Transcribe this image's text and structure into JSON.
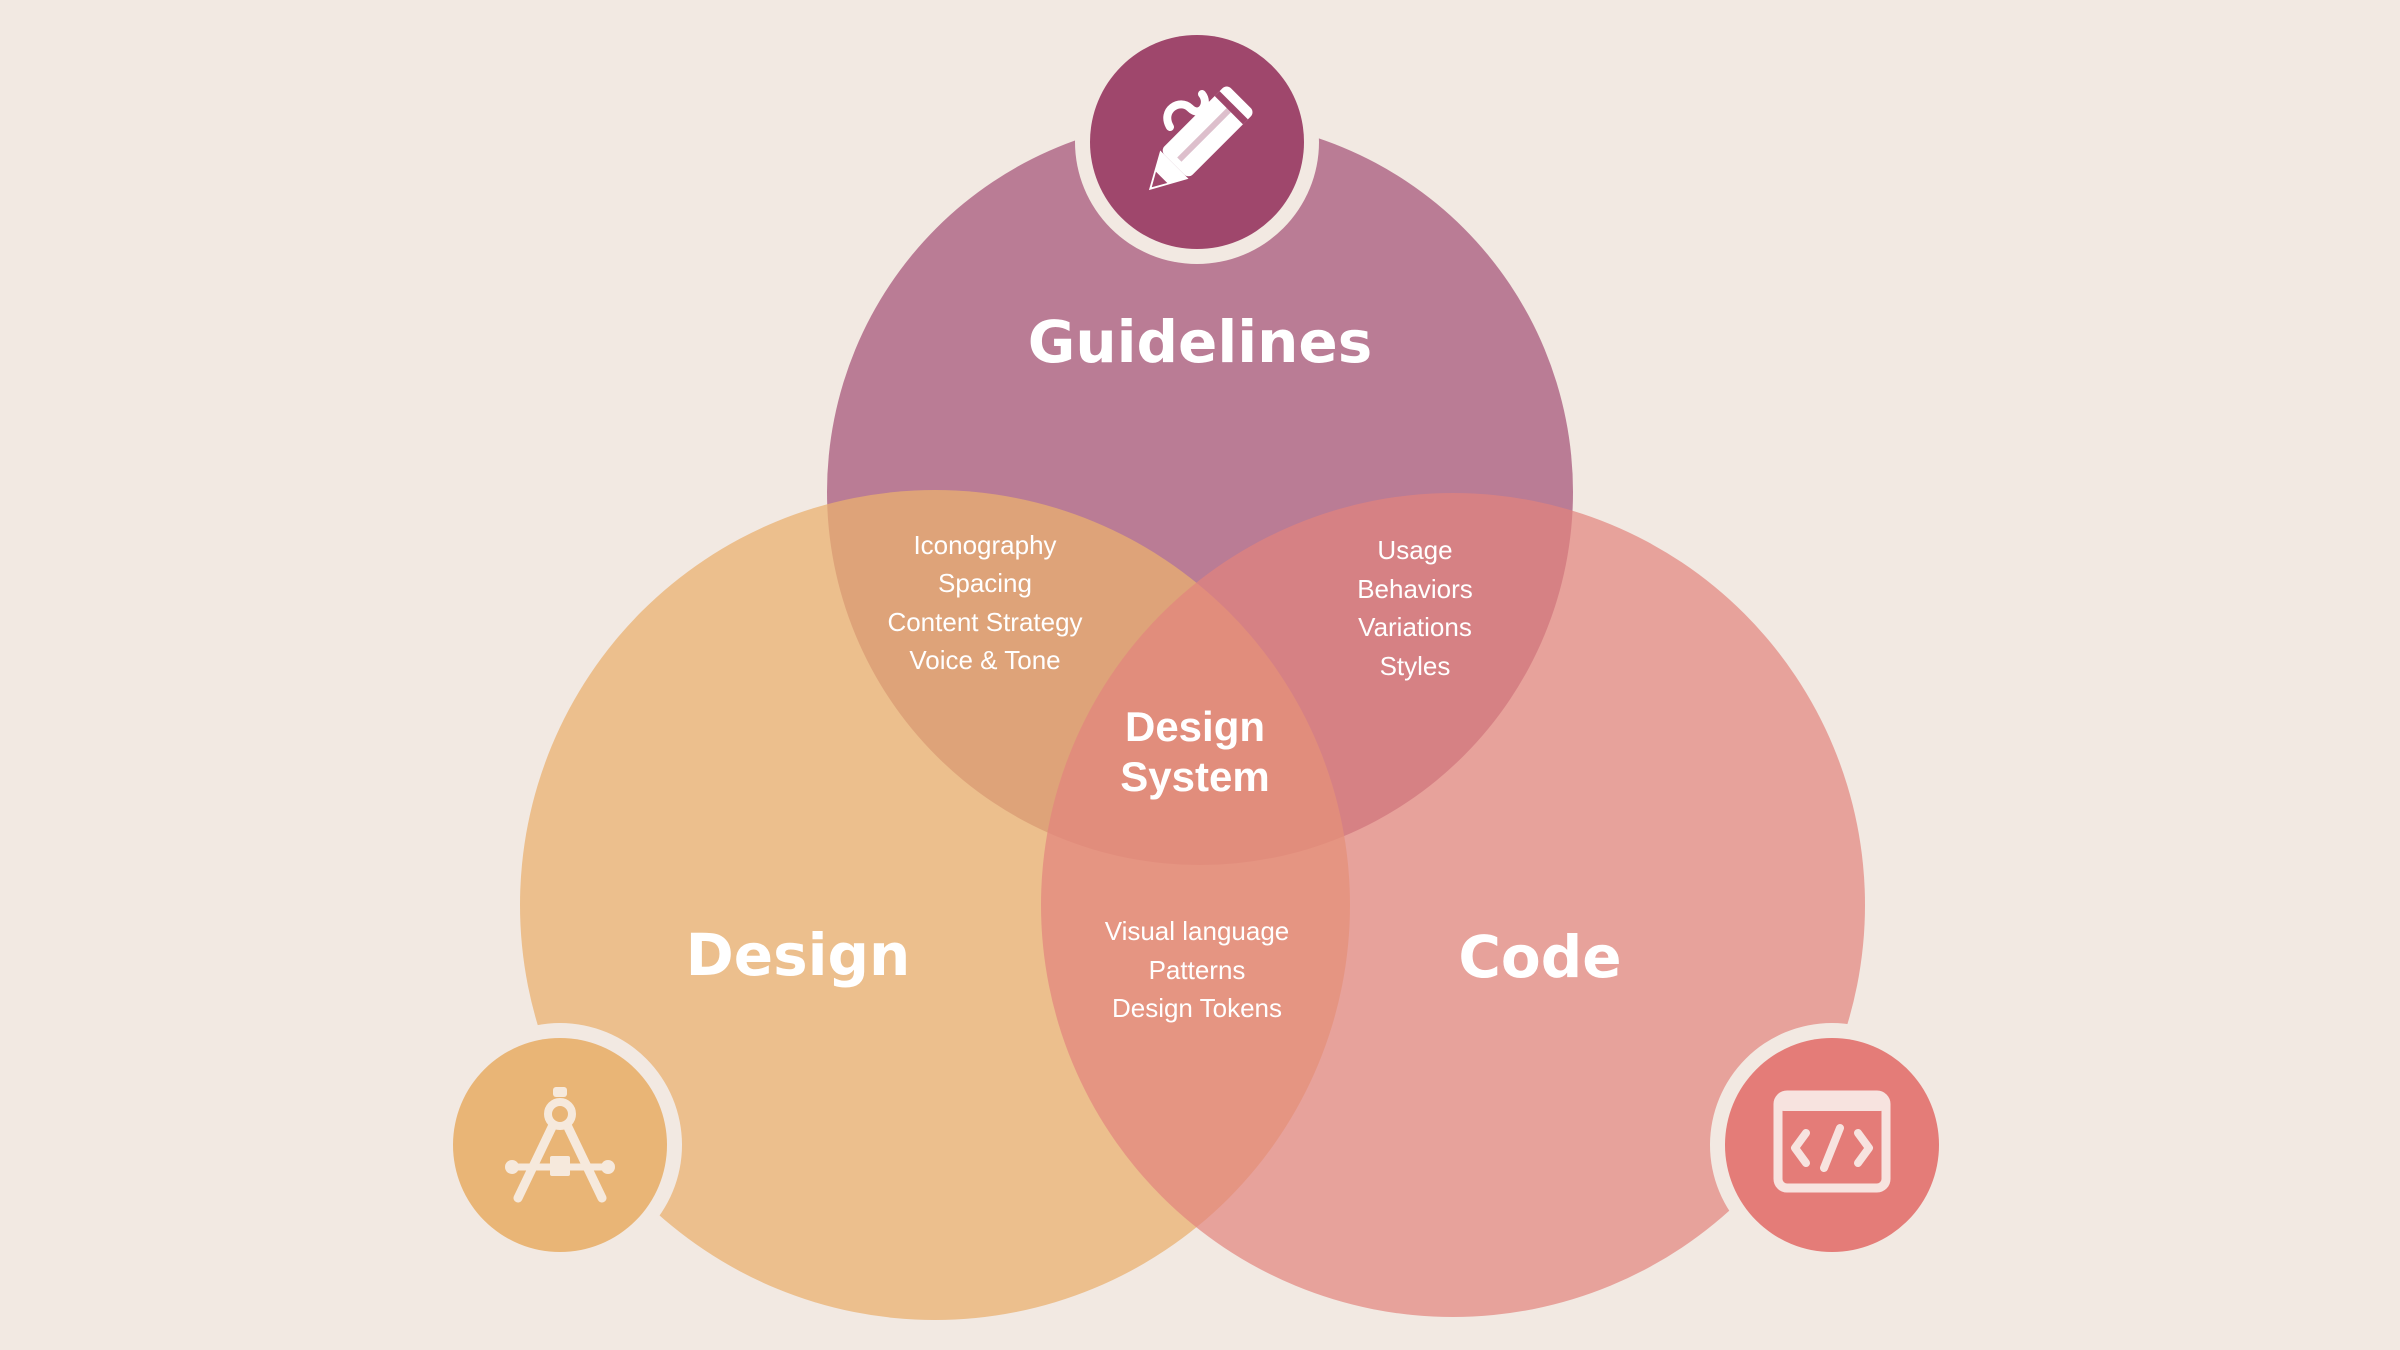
{
  "colors": {
    "background": "#f2e9e2",
    "guidelines": "#a24d75",
    "design": "#e9b070",
    "code": "#e2837e",
    "guidelines_badge": "#9f476c",
    "design_badge": "#e9b576",
    "code_badge": "#e47c78"
  },
  "circles": {
    "guidelines": {
      "title": "Guidelines",
      "icon": "pen-icon"
    },
    "design": {
      "title": "Design",
      "icon": "drafting-compass-icon"
    },
    "code": {
      "title": "Code",
      "icon": "code-window-icon"
    }
  },
  "overlaps": {
    "guidelines_design": [
      "Iconography",
      "Spacing",
      "Content Strategy",
      "Voice & Tone"
    ],
    "guidelines_code": [
      "Usage",
      "Behaviors",
      "Variations",
      "Styles"
    ],
    "design_code": [
      "Visual language",
      "Patterns",
      "Design Tokens"
    ],
    "center": [
      "Design",
      "System"
    ]
  }
}
